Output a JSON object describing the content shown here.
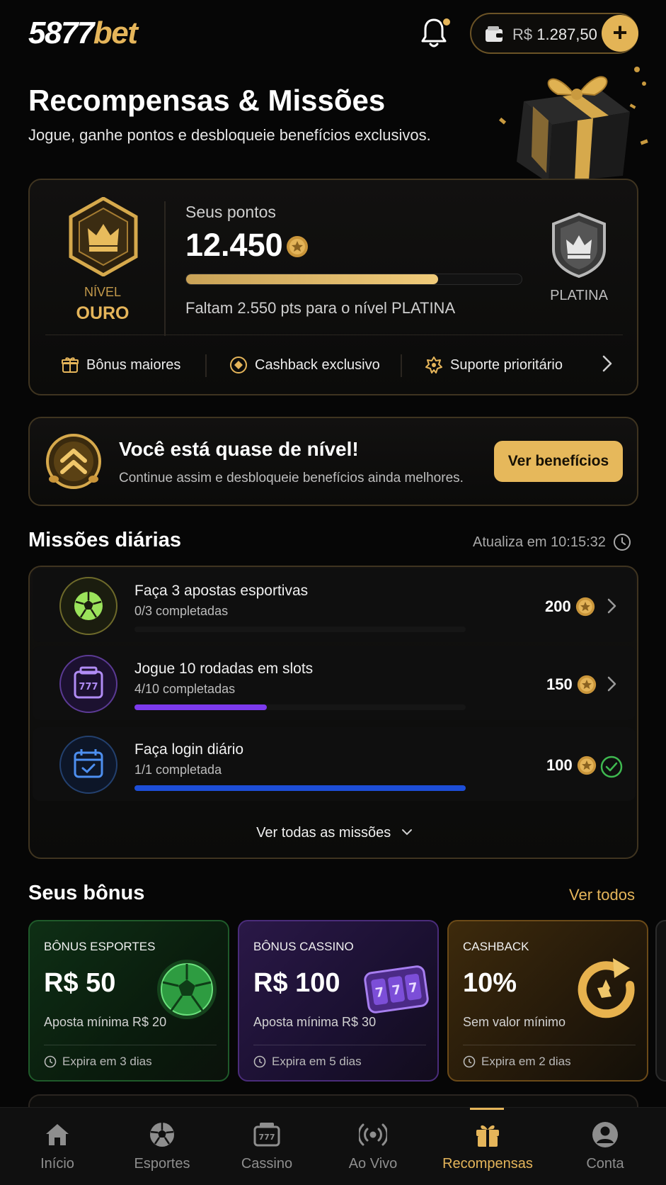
{
  "header": {
    "logo_num": "5877",
    "logo_brand": "bet",
    "balance_currency": "R$",
    "balance_amount": "1.287,50",
    "add_label": "+"
  },
  "hero": {
    "title": "Recompensas & Missões",
    "subtitle": "Jogue, ganhe pontos e desbloqueie benefícios exclusivos."
  },
  "points": {
    "level_label": "NÍVEL",
    "level_value": "OURO",
    "points_label": "Seus pontos",
    "points_value": "12.450",
    "progress_fraction": 0.75,
    "remaining_text": "Faltam 2.550 pts para o nível PLATINA",
    "next_level": "PLATINA",
    "perks": [
      {
        "label": "Bônus maiores",
        "icon": "gift-box-icon"
      },
      {
        "label": "Cashback exclusivo",
        "icon": "coin-badge-icon"
      },
      {
        "label": "Suporte prioritário",
        "icon": "support-flower-icon"
      }
    ]
  },
  "level_banner": {
    "title": "Você está quase de nível!",
    "subtitle": "Continue assim e desbloqueie benefícios ainda melhores.",
    "button": "Ver benefícios"
  },
  "missions": {
    "title": "Missões diárias",
    "refresh_text": "Atualiza em 10:15:32",
    "items": [
      {
        "title": "Faça 3 apostas esportivas",
        "progress_text": "0/3 completadas",
        "progress": 0.0,
        "reward": "200",
        "color": "#1a1a1a",
        "icon": "soccer-ball-icon",
        "status": "open"
      },
      {
        "title": "Jogue 10 rodadas em slots",
        "progress_text": "4/10 completadas",
        "progress": 0.4,
        "reward": "150",
        "color": "#7c3aed",
        "icon": "slot-machine-icon",
        "status": "open"
      },
      {
        "title": "Faça login diário",
        "progress_text": "1/1 completada",
        "progress": 1.0,
        "reward": "100",
        "color": "#1d4ed8",
        "icon": "calendar-check-icon",
        "status": "done"
      }
    ],
    "see_all": "Ver todas as missões"
  },
  "bonuses": {
    "title": "Seus bônus",
    "see_all": "Ver todos",
    "items": [
      {
        "label": "BÔNUS ESPORTES",
        "value": "R$ 50",
        "sub": "Aposta mínima R$ 20",
        "expires": "Expira em 3 dias",
        "accent": "#2ea043"
      },
      {
        "label": "BÔNUS CASSINO",
        "value": "R$ 100",
        "sub": "Aposta mínima R$ 30",
        "expires": "Expira em 5 dias",
        "accent": "#8b5cf6"
      },
      {
        "label": "CASHBACK",
        "value": "10%",
        "sub": "Sem valor mínimo",
        "expires": "Expira em 2 dias",
        "accent": "#e5b55a"
      }
    ]
  },
  "nav": {
    "items": [
      {
        "label": "Início",
        "icon": "home-icon"
      },
      {
        "label": "Esportes",
        "icon": "soccer-icon"
      },
      {
        "label": "Cassino",
        "icon": "slot-icon"
      },
      {
        "label": "Ao Vivo",
        "icon": "live-icon"
      },
      {
        "label": "Recompensas",
        "icon": "gift-icon",
        "active": true
      },
      {
        "label": "Conta",
        "icon": "user-icon"
      }
    ]
  },
  "colors": {
    "accent_gold": "#e5b55a",
    "background": "#060606"
  }
}
